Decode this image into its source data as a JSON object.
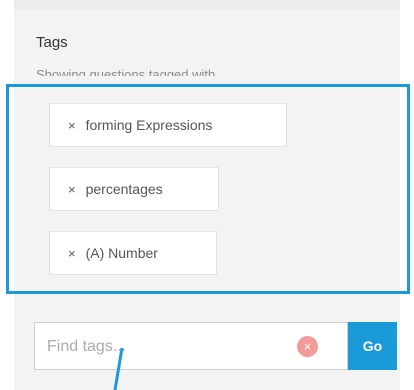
{
  "tags_panel": {
    "title": "Tags",
    "subtitle": "Showing questions tagged with",
    "tags": [
      {
        "remove_icon": "×",
        "label": "forming Expressions"
      },
      {
        "remove_icon": "×",
        "label": "percentages"
      },
      {
        "remove_icon": "×",
        "label": "(A) Number"
      }
    ]
  },
  "search": {
    "placeholder": "Find tags...",
    "clear_icon": "×",
    "go_label": "Go"
  },
  "colors": {
    "accent": "#1a9ad9",
    "clear": "#f39a9a",
    "panel_bg": "#f3f3f3"
  }
}
